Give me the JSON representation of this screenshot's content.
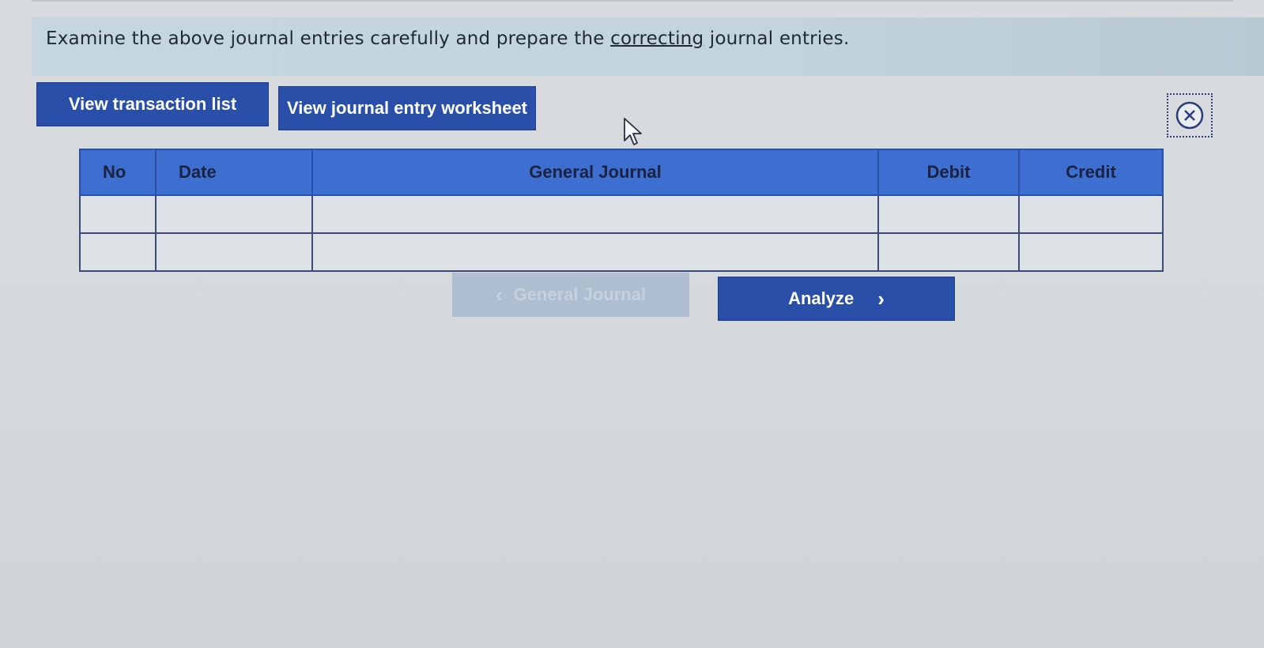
{
  "instruction": {
    "before": "Examine the above journal entries carefully and prepare the ",
    "underlined": "correcting",
    "after": " journal entries."
  },
  "buttons": {
    "view_transactions": "View transaction list",
    "view_worksheet": "View journal entry worksheet",
    "prev_label": "General Journal",
    "analyze_label": "Analyze"
  },
  "icons": {
    "close": "close-circle-icon",
    "prev": "chevron-left-icon",
    "next": "chevron-right-icon",
    "cursor": "mouse-pointer-icon"
  },
  "table": {
    "headers": [
      "No",
      "Date",
      "General Journal",
      "Debit",
      "Credit"
    ],
    "rows": [
      [
        "",
        "",
        "",
        "",
        ""
      ],
      [
        "",
        "",
        "",
        "",
        ""
      ]
    ]
  },
  "colors": {
    "primary_button": "#2a4fa8",
    "table_header": "#3d6fd0",
    "instruction_bar": "#c6d6de"
  }
}
